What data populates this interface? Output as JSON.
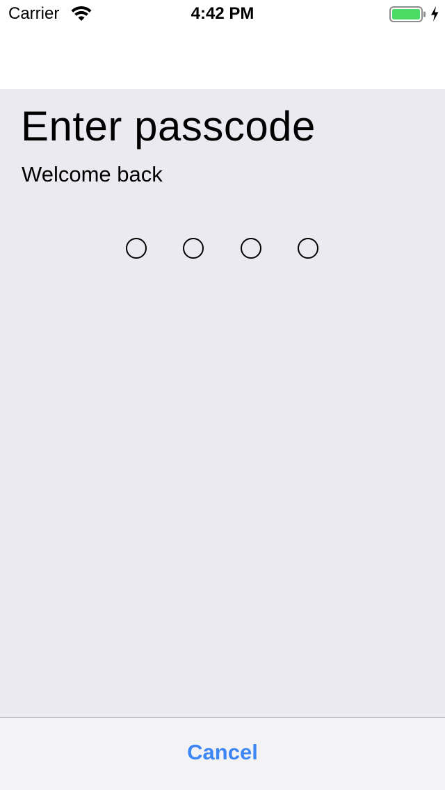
{
  "status_bar": {
    "carrier": "Carrier",
    "time": "4:42 PM",
    "wifi_icon": "wifi-icon",
    "battery_icon": "battery-icon",
    "charging_icon": "charging-bolt-icon",
    "battery_level": 1.0,
    "battery_color": "#4cd964"
  },
  "passcode": {
    "title": "Enter passcode",
    "subtitle": "Welcome back",
    "digit_count": 4,
    "digits_entered": 0
  },
  "toolbar": {
    "cancel_label": "Cancel",
    "accent_color": "#3d87f5"
  },
  "colors": {
    "content_background": "#ebeaf0",
    "toolbar_background": "#f3f3f5"
  }
}
